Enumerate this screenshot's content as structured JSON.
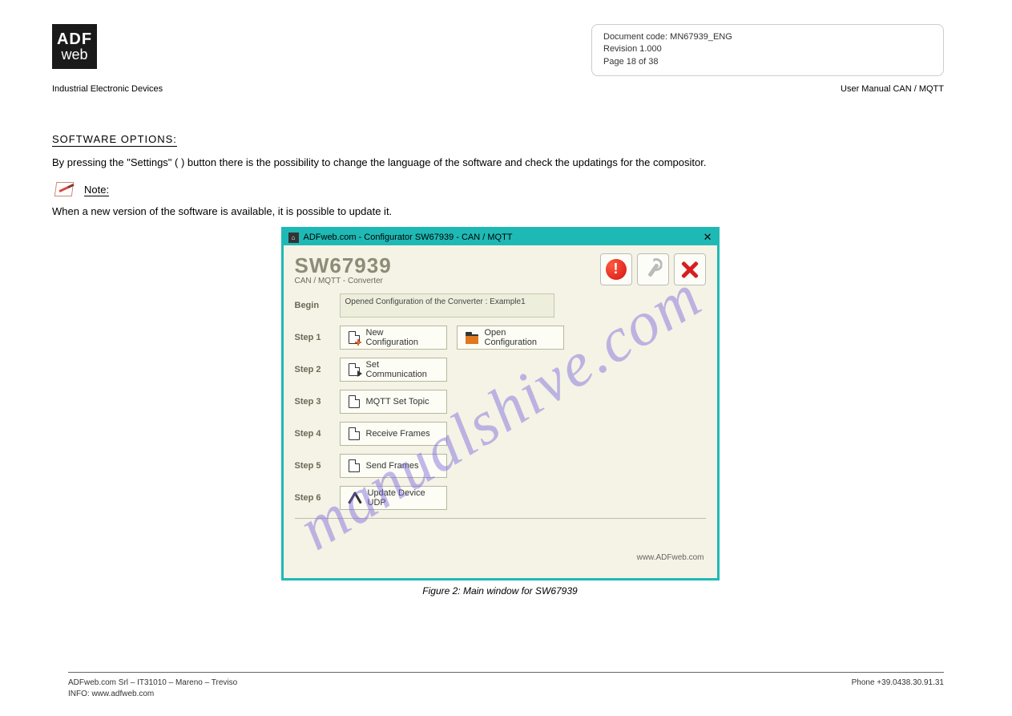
{
  "logo": {
    "line1": "ADF",
    "line2": "web"
  },
  "reader_left": "Industrial Electronic Devices",
  "info_box": {
    "l1": "Document code: MN67939_ENG",
    "l2": "Revision 1.000",
    "l3": "Page 18 of 38"
  },
  "top_right": "User Manual CAN / MQTT",
  "heading": "SOFTWARE OPTIONS:",
  "body_line": "By pressing the \"Settings\" (  ) button there is the possibility to change the language of the software and check the updatings for the compositor.",
  "note_label": "Note:",
  "note_text": "When a new version of the software is available, it is possible to update it.",
  "screenshot": {
    "titlebar": "ADFweb.com - Configurator SW67939 - CAN / MQTT",
    "title": "SW67939",
    "subtitle": "CAN / MQTT - Converter",
    "begin_label": "Begin",
    "begin_text": "Opened Configuration of the Converter : Example1",
    "steps": {
      "s1": "Step 1",
      "s2": "Step 2",
      "s3": "Step 3",
      "s4": "Step 4",
      "s5": "Step 5",
      "s6": "Step 6"
    },
    "buttons": {
      "new_conf": "New Configuration",
      "open_conf": "Open Configuration",
      "set_comm": "Set Communication",
      "mqtt_topic": "MQTT Set Topic",
      "recv_frames": "Receive Frames",
      "send_frames": "Send Frames",
      "update_udp": "Update Device UDP"
    },
    "footer_url": "www.ADFweb.com"
  },
  "caption": "Figure 2: Main window for SW67939",
  "watermark": "manualshive.com",
  "footer": {
    "left_l1": "ADFweb.com Srl – IT31010 – Mareno – Treviso",
    "left_l2": "INFO: www.adfweb.com",
    "right_l1": "Phone +39.0438.30.91.31"
  }
}
